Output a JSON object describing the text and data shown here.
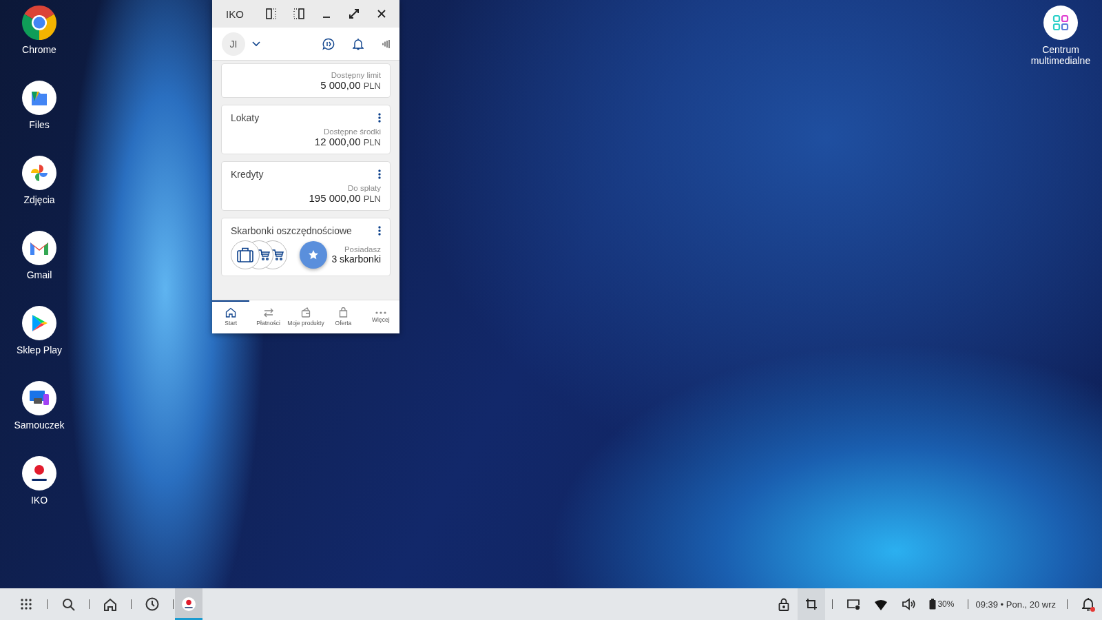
{
  "desktop_icons": [
    {
      "label": "Chrome",
      "kind": "chrome"
    },
    {
      "label": "Files",
      "kind": "files"
    },
    {
      "label": "Zdjęcia",
      "kind": "photos"
    },
    {
      "label": "Gmail",
      "kind": "gmail"
    },
    {
      "label": "Sklep Play",
      "kind": "play"
    },
    {
      "label": "Samouczek",
      "kind": "tutorial"
    },
    {
      "label": "IKO",
      "kind": "iko"
    }
  ],
  "desktop_icons_right": [
    {
      "label": "Centrum multimedialne",
      "kind": "media"
    }
  ],
  "window": {
    "title": "IKO",
    "avatar": "JI",
    "cards": [
      {
        "kind": "amount",
        "label": "Dostępny limit",
        "amount": "5 000,00",
        "currency": "PLN"
      },
      {
        "kind": "amount",
        "title": "Lokaty",
        "label": "Dostępne środki",
        "amount": "12 000,00",
        "currency": "PLN"
      },
      {
        "kind": "amount",
        "title": "Kredyty",
        "label": "Do spłaty",
        "amount": "195 000,00",
        "currency": "PLN"
      },
      {
        "kind": "piggy",
        "title": "Skarbonki oszczędnościowe",
        "label": "Posiadasz",
        "amount": "3 skarbonki",
        "goals": [
          {
            "kind": "suitcase"
          },
          {
            "kind": "cart"
          },
          {
            "kind": "cart"
          }
        ]
      }
    ],
    "nav": [
      {
        "label": "Start",
        "kind": "home",
        "selected": true
      },
      {
        "label": "Płatności",
        "kind": "transfer",
        "selected": false
      },
      {
        "label": "Moje produkty",
        "kind": "wallet",
        "selected": false
      },
      {
        "label": "Oferta",
        "kind": "bag",
        "selected": false
      },
      {
        "label": "Więcej",
        "kind": "more",
        "selected": false
      }
    ]
  },
  "taskbar": {
    "launchers": [
      {
        "kind": "apps"
      },
      {
        "kind": "search"
      },
      {
        "kind": "home"
      },
      {
        "kind": "recent"
      }
    ],
    "running": [
      {
        "kind": "iko",
        "selected": true
      }
    ],
    "battery": "30%",
    "clock": "09:39 • Pon., 20 wrz",
    "notifications_unread": true
  }
}
